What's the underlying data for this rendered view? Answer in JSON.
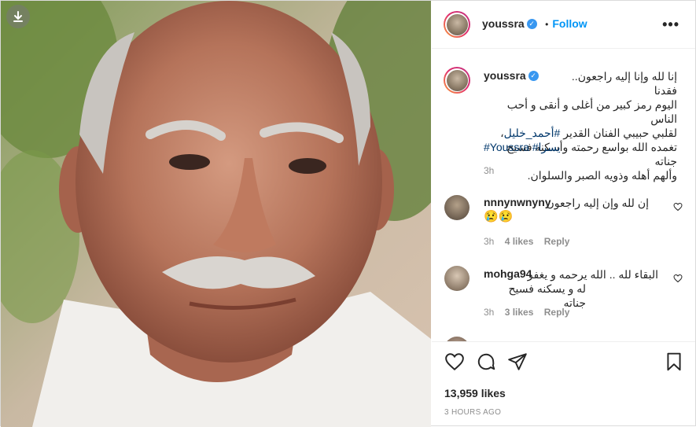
{
  "header": {
    "username": "youssra",
    "follow_label": "Follow",
    "separator": "•",
    "more_icon": "more-dots-icon"
  },
  "caption": {
    "username": "youssra",
    "text_line1": "إنا لله وإنا إليه راجعون.. فقدنا",
    "text_line2": "اليوم رمز كبير من أغلى و أنقى و أحب الناس",
    "text_line3_prefix": "لقلبي حبيبي الفنان القدير ",
    "text_line3_tag": "#أحمد_خليل",
    "text_line3_suffix": "،",
    "text_line4": "تغمده الله بواسع رحمته وأسكنه فسيح جناته",
    "text_line5": "وألهم أهله وذويه الصبر والسلوان.",
    "tags_line": "#Youssra #يسرا",
    "time": "3h"
  },
  "comments": [
    {
      "username": "nnnynwnyny",
      "text": "إن لله وإن إليه راجعون",
      "emoji": "😢😢",
      "time": "3h",
      "likes": "4 likes",
      "reply": "Reply"
    },
    {
      "username": "mohga94",
      "text_line1": "البقاء لله .. الله يرحمه و يغفر",
      "text_line2": "له و يسكنه فسيح جناته",
      "time": "3h",
      "likes": "3 likes",
      "reply": "Reply"
    }
  ],
  "actions": {
    "like_icon": "heart-icon",
    "comment_icon": "comment-icon",
    "share_icon": "share-icon",
    "save_icon": "bookmark-icon",
    "likes_count": "13,959 likes",
    "timestamp": "3 HOURS AGO"
  },
  "colors": {
    "accent": "#0095f6",
    "verified": "#3897f0",
    "text": "#262626",
    "muted": "#8e8e8e",
    "hashtag": "#00376b"
  }
}
